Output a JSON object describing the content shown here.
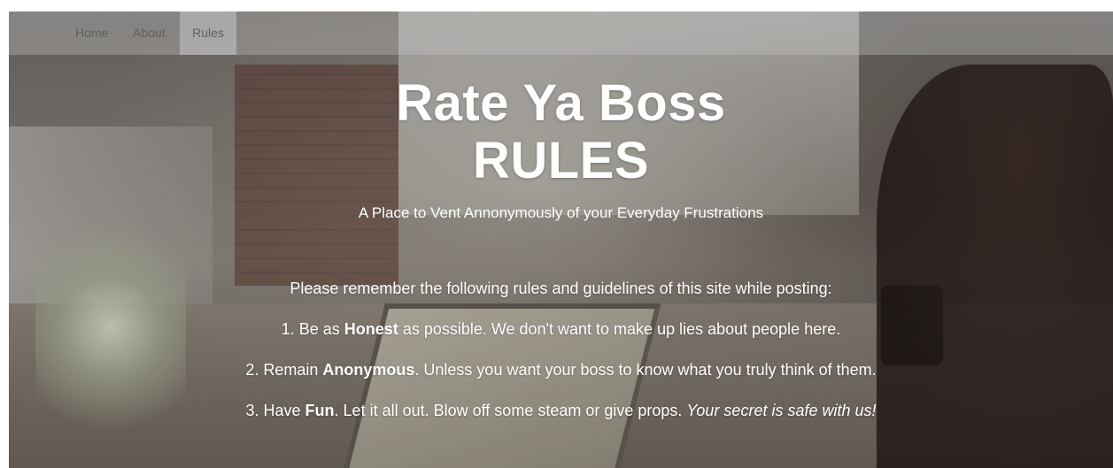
{
  "nav": {
    "home": "Home",
    "about": "About",
    "rules": "Rules"
  },
  "hero": {
    "title_line1": "Rate Ya Boss",
    "title_line2": "RULES",
    "subtitle": "A Place to Vent Annonymously of your Everyday Frustrations"
  },
  "rules": {
    "intro": "Please remember the following rules and guidelines of this site while posting:",
    "items": [
      {
        "prefix": "1. Be as ",
        "bold": "Honest",
        "rest": " as possible. We don't want to make up lies about people here.",
        "italic": ""
      },
      {
        "prefix": "2. Remain ",
        "bold": "Anonymous",
        "rest": ". Unless you want your boss to know what you truly think of them.",
        "italic": ""
      },
      {
        "prefix": "3. Have ",
        "bold": "Fun",
        "rest": ". Let it all out. Blow off some steam or give props. ",
        "italic": "Your secret is safe with us!"
      }
    ]
  },
  "colors": {
    "text": "#ffffff",
    "nav_text": "#5f5f5f",
    "navbar_bg": "rgba(200,200,200,0.35)"
  }
}
